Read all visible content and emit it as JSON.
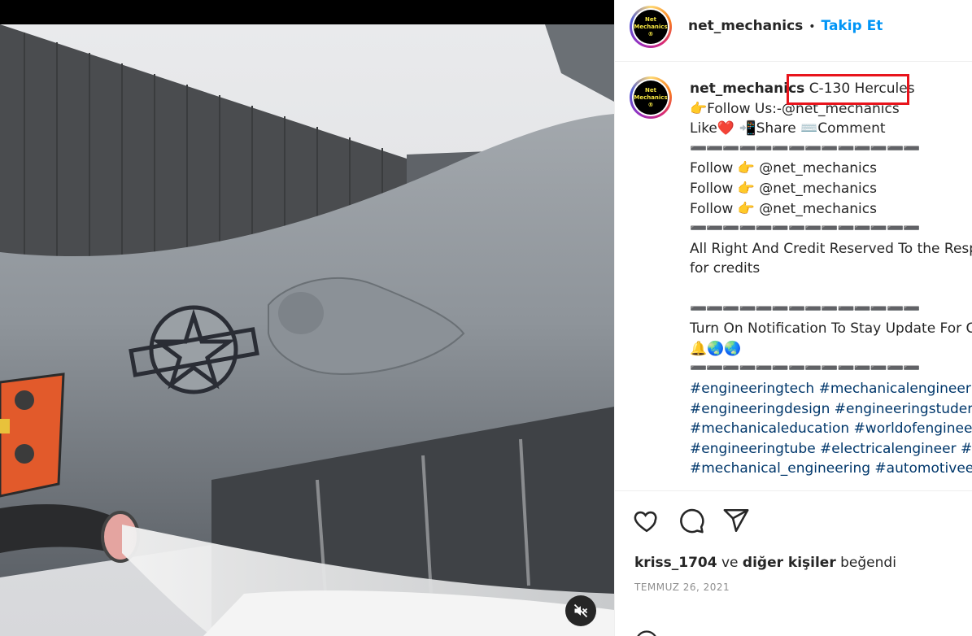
{
  "post": {
    "username": "net_mechanics",
    "follow_label": "Takip Et",
    "separator": "•",
    "avatar_text_line1": "Net",
    "avatar_text_line2": "Mechanics ®"
  },
  "caption": {
    "username": "net_mechanics",
    "title": "C-130 Hercules",
    "lines": [
      "👉Follow Us:-@net_mechanics",
      "Like❤️ 📲Share ⌨️Comment",
      "➖➖➖➖➖➖➖➖➖➖➖➖➖➖",
      "Follow 👉 @net_mechanics",
      "Follow 👉 @net_mechanics",
      "Follow 👉 @net_mechanics",
      "➖➖➖➖➖➖➖➖➖➖➖➖➖➖",
      "All Right And Credit Reserved To the Resp",
      "for credits",
      "",
      "➖➖➖➖➖➖➖➖➖➖➖➖➖➖",
      "Turn On Notification To Stay Update For C",
      "🔔🌏🌏",
      "➖➖➖➖➖➖➖➖➖➖➖➖➖➖",
      "#engineeringtech #mechanicalengineer #",
      "#engineeringdesign #engineeringstudent",
      "#mechanicaleducation #worldofengineer",
      "#engineeringtube #electricalengineer #en",
      "#mechanical_engineering #automotiveen"
    ]
  },
  "actions": {
    "like_icon": "heart-icon",
    "comment_icon": "comment-icon",
    "share_icon": "share-icon",
    "liked_by_user": "kriss_1704",
    "liked_by_middle": " ve ",
    "liked_by_others": "diğer kişiler",
    "liked_by_suffix": " beğendi",
    "date": "TEMMUZ 26, 2021"
  },
  "media": {
    "mute_icon": "muted-speaker-icon",
    "highlight_color": "#e8141c"
  }
}
